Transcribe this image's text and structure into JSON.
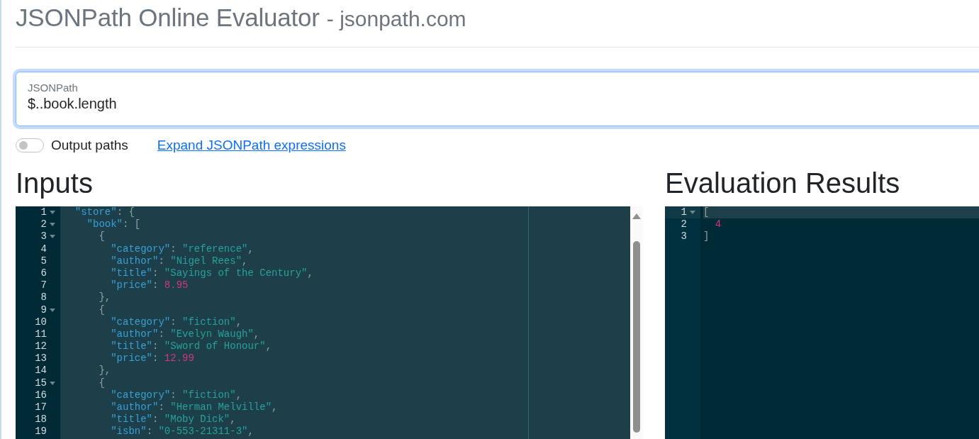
{
  "header": {
    "title": "JSONPath Online Evaluator",
    "subtitle": "- jsonpath.com"
  },
  "jsonpath_field": {
    "label": "JSONPath",
    "value": "$..book.length"
  },
  "output_paths_toggle": {
    "label": "Output paths",
    "on": false
  },
  "expand_link": "Expand JSONPath expressions",
  "inputs": {
    "heading": "Inputs",
    "lines": [
      {
        "number": "1",
        "foldable": true,
        "active": false,
        "tokens": [
          {
            "kind": "key",
            "text": "  \"store\""
          },
          {
            "kind": "punct",
            "text": ": {"
          }
        ]
      },
      {
        "number": "2",
        "foldable": true,
        "active": false,
        "tokens": [
          {
            "kind": "key",
            "text": "    \"book\""
          },
          {
            "kind": "punct",
            "text": ": ["
          }
        ]
      },
      {
        "number": "3",
        "foldable": true,
        "active": false,
        "tokens": [
          {
            "kind": "punct",
            "text": "      {"
          }
        ]
      },
      {
        "number": "4",
        "foldable": false,
        "active": false,
        "tokens": [
          {
            "kind": "key",
            "text": "        \"category\""
          },
          {
            "kind": "punct",
            "text": ": "
          },
          {
            "kind": "string",
            "text": "\"reference\""
          },
          {
            "kind": "punct",
            "text": ","
          }
        ]
      },
      {
        "number": "5",
        "foldable": false,
        "active": false,
        "tokens": [
          {
            "kind": "key",
            "text": "        \"author\""
          },
          {
            "kind": "punct",
            "text": ": "
          },
          {
            "kind": "string",
            "text": "\"Nigel Rees\""
          },
          {
            "kind": "punct",
            "text": ","
          }
        ]
      },
      {
        "number": "6",
        "foldable": false,
        "active": false,
        "tokens": [
          {
            "kind": "key",
            "text": "        \"title\""
          },
          {
            "kind": "punct",
            "text": ": "
          },
          {
            "kind": "string",
            "text": "\"Sayings of the Century\""
          },
          {
            "kind": "punct",
            "text": ","
          }
        ]
      },
      {
        "number": "7",
        "foldable": false,
        "active": false,
        "tokens": [
          {
            "kind": "key",
            "text": "        \"price\""
          },
          {
            "kind": "punct",
            "text": ": "
          },
          {
            "kind": "number",
            "text": "8.95"
          }
        ]
      },
      {
        "number": "8",
        "foldable": false,
        "active": false,
        "tokens": [
          {
            "kind": "punct",
            "text": "      },"
          }
        ]
      },
      {
        "number": "9",
        "foldable": true,
        "active": false,
        "tokens": [
          {
            "kind": "punct",
            "text": "      {"
          }
        ]
      },
      {
        "number": "10",
        "foldable": false,
        "active": false,
        "tokens": [
          {
            "kind": "key",
            "text": "        \"category\""
          },
          {
            "kind": "punct",
            "text": ": "
          },
          {
            "kind": "string",
            "text": "\"fiction\""
          },
          {
            "kind": "punct",
            "text": ","
          }
        ]
      },
      {
        "number": "11",
        "foldable": false,
        "active": false,
        "tokens": [
          {
            "kind": "key",
            "text": "        \"author\""
          },
          {
            "kind": "punct",
            "text": ": "
          },
          {
            "kind": "string",
            "text": "\"Evelyn Waugh\""
          },
          {
            "kind": "punct",
            "text": ","
          }
        ]
      },
      {
        "number": "12",
        "foldable": false,
        "active": false,
        "tokens": [
          {
            "kind": "key",
            "text": "        \"title\""
          },
          {
            "kind": "punct",
            "text": ": "
          },
          {
            "kind": "string",
            "text": "\"Sword of Honour\""
          },
          {
            "kind": "punct",
            "text": ","
          }
        ]
      },
      {
        "number": "13",
        "foldable": false,
        "active": false,
        "tokens": [
          {
            "kind": "key",
            "text": "        \"price\""
          },
          {
            "kind": "punct",
            "text": ": "
          },
          {
            "kind": "number",
            "text": "12.99"
          }
        ]
      },
      {
        "number": "14",
        "foldable": false,
        "active": false,
        "tokens": [
          {
            "kind": "punct",
            "text": "      },"
          }
        ]
      },
      {
        "number": "15",
        "foldable": true,
        "active": false,
        "tokens": [
          {
            "kind": "punct",
            "text": "      {"
          }
        ]
      },
      {
        "number": "16",
        "foldable": false,
        "active": false,
        "tokens": [
          {
            "kind": "key",
            "text": "        \"category\""
          },
          {
            "kind": "punct",
            "text": ": "
          },
          {
            "kind": "string",
            "text": "\"fiction\""
          },
          {
            "kind": "punct",
            "text": ","
          }
        ]
      },
      {
        "number": "17",
        "foldable": false,
        "active": false,
        "tokens": [
          {
            "kind": "key",
            "text": "        \"author\""
          },
          {
            "kind": "punct",
            "text": ": "
          },
          {
            "kind": "string",
            "text": "\"Herman Melville\""
          },
          {
            "kind": "punct",
            "text": ","
          }
        ]
      },
      {
        "number": "18",
        "foldable": false,
        "active": false,
        "tokens": [
          {
            "kind": "key",
            "text": "        \"title\""
          },
          {
            "kind": "punct",
            "text": ": "
          },
          {
            "kind": "string",
            "text": "\"Moby Dick\""
          },
          {
            "kind": "punct",
            "text": ","
          }
        ]
      },
      {
        "number": "19",
        "foldable": false,
        "active": false,
        "tokens": [
          {
            "kind": "key",
            "text": "        \"isbn\""
          },
          {
            "kind": "punct",
            "text": ": "
          },
          {
            "kind": "string",
            "text": "\"0-553-21311-3\""
          },
          {
            "kind": "punct",
            "text": ","
          }
        ]
      }
    ]
  },
  "results": {
    "heading": "Evaluation Results",
    "lines": [
      {
        "number": "1",
        "foldable": true,
        "active": true,
        "tokens": [
          {
            "kind": "punct",
            "text": "["
          }
        ]
      },
      {
        "number": "2",
        "foldable": false,
        "active": false,
        "tokens": [
          {
            "kind": "number",
            "text": "  4"
          }
        ]
      },
      {
        "number": "3",
        "foldable": false,
        "active": false,
        "tokens": [
          {
            "kind": "punct",
            "text": "]"
          }
        ]
      }
    ]
  }
}
